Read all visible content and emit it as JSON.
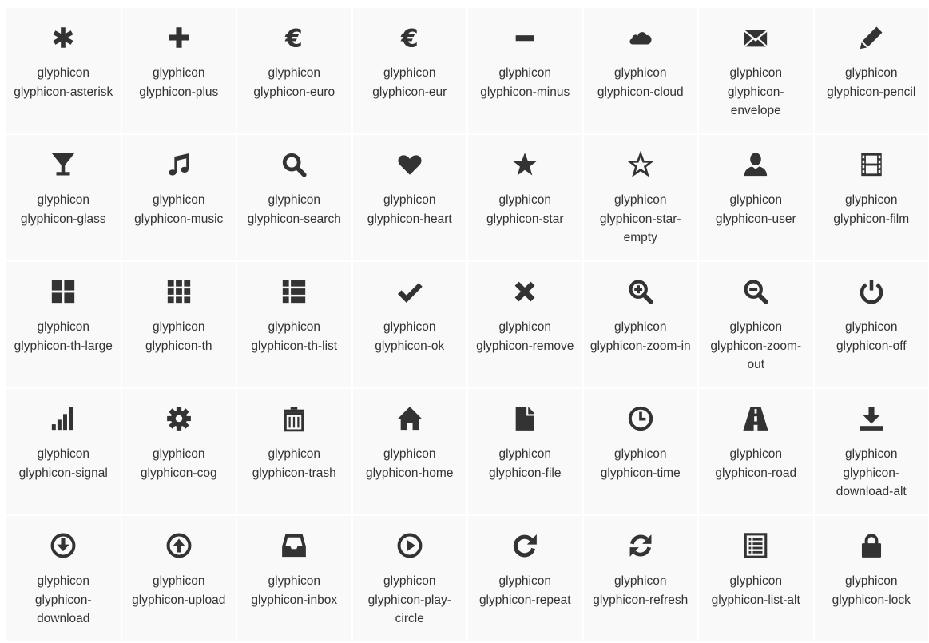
{
  "icon_color": "#333333",
  "cell_background": "#f9f9f9",
  "glyphs": [
    {
      "icon": "asterisk-icon",
      "name": "glyphicon glyphicon-asterisk"
    },
    {
      "icon": "plus-icon",
      "name": "glyphicon glyphicon-plus"
    },
    {
      "icon": "euro-icon",
      "name": "glyphicon glyphicon-euro"
    },
    {
      "icon": "eur-icon",
      "name": "glyphicon glyphicon-eur"
    },
    {
      "icon": "minus-icon",
      "name": "glyphicon glyphicon-minus"
    },
    {
      "icon": "cloud-icon",
      "name": "glyphicon glyphicon-cloud"
    },
    {
      "icon": "envelope-icon",
      "name": "glyphicon glyphicon-envelope"
    },
    {
      "icon": "pencil-icon",
      "name": "glyphicon glyphicon-pencil"
    },
    {
      "icon": "glass-icon",
      "name": "glyphicon glyphicon-glass"
    },
    {
      "icon": "music-icon",
      "name": "glyphicon glyphicon-music"
    },
    {
      "icon": "search-icon",
      "name": "glyphicon glyphicon-search"
    },
    {
      "icon": "heart-icon",
      "name": "glyphicon glyphicon-heart"
    },
    {
      "icon": "star-icon",
      "name": "glyphicon glyphicon-star"
    },
    {
      "icon": "star-empty-icon",
      "name": "glyphicon glyphicon-star-empty"
    },
    {
      "icon": "user-icon",
      "name": "glyphicon glyphicon-user"
    },
    {
      "icon": "film-icon",
      "name": "glyphicon glyphicon-film"
    },
    {
      "icon": "th-large-icon",
      "name": "glyphicon glyphicon-th-large"
    },
    {
      "icon": "th-icon",
      "name": "glyphicon glyphicon-th"
    },
    {
      "icon": "th-list-icon",
      "name": "glyphicon glyphicon-th-list"
    },
    {
      "icon": "ok-icon",
      "name": "glyphicon glyphicon-ok"
    },
    {
      "icon": "remove-icon",
      "name": "glyphicon glyphicon-remove"
    },
    {
      "icon": "zoom-in-icon",
      "name": "glyphicon glyphicon-zoom-in"
    },
    {
      "icon": "zoom-out-icon",
      "name": "glyphicon glyphicon-zoom-out"
    },
    {
      "icon": "off-icon",
      "name": "glyphicon glyphicon-off"
    },
    {
      "icon": "signal-icon",
      "name": "glyphicon glyphicon-signal"
    },
    {
      "icon": "cog-icon",
      "name": "glyphicon glyphicon-cog"
    },
    {
      "icon": "trash-icon",
      "name": "glyphicon glyphicon-trash"
    },
    {
      "icon": "home-icon",
      "name": "glyphicon glyphicon-home"
    },
    {
      "icon": "file-icon",
      "name": "glyphicon glyphicon-file"
    },
    {
      "icon": "time-icon",
      "name": "glyphicon glyphicon-time"
    },
    {
      "icon": "road-icon",
      "name": "glyphicon glyphicon-road"
    },
    {
      "icon": "download-alt-icon",
      "name": "glyphicon glyphicon-download-alt"
    },
    {
      "icon": "download-icon",
      "name": "glyphicon glyphicon-download"
    },
    {
      "icon": "upload-icon",
      "name": "glyphicon glyphicon-upload"
    },
    {
      "icon": "inbox-icon",
      "name": "glyphicon glyphicon-inbox"
    },
    {
      "icon": "play-circle-icon",
      "name": "glyphicon glyphicon-play-circle"
    },
    {
      "icon": "repeat-icon",
      "name": "glyphicon glyphicon-repeat"
    },
    {
      "icon": "refresh-icon",
      "name": "glyphicon glyphicon-refresh"
    },
    {
      "icon": "list-alt-icon",
      "name": "glyphicon glyphicon-list-alt"
    },
    {
      "icon": "lock-icon",
      "name": "glyphicon glyphicon-lock"
    }
  ]
}
